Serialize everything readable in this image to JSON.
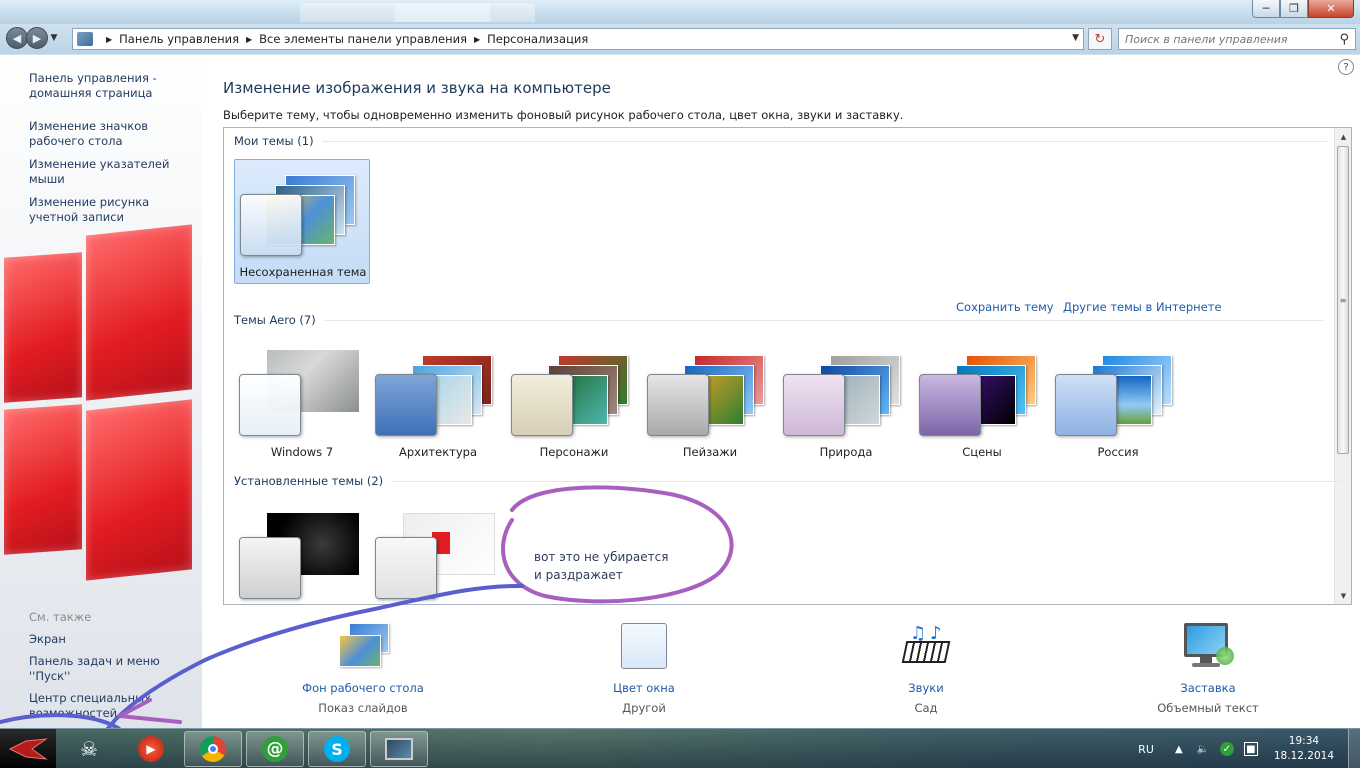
{
  "address_bar": {
    "breadcrumbs": [
      "Панель управления",
      "Все элементы панели управления",
      "Персонализация"
    ],
    "search_placeholder": "Поиск в панели управления"
  },
  "sidebar": {
    "links": [
      "Панель управления - домашняя страница",
      "Изменение значков рабочего стола",
      "Изменение указателей мыши",
      "Изменение рисунка учетной записи"
    ],
    "see_also_label": "См. также",
    "see_also_links": [
      "Экран",
      "Панель задач и меню ''Пуск''",
      "Центр специальных возможностей"
    ]
  },
  "main": {
    "title": "Изменение изображения и звука на компьютере",
    "description": "Выберите тему, чтобы одновременно изменить фоновый рисунок рабочего стола, цвет окна, звуки и заставку.",
    "groups": {
      "my_themes": {
        "label": "Мои темы (1)",
        "themes": [
          "Несохраненная тема"
        ]
      },
      "aero_themes": {
        "label": "Темы Aero (7)",
        "themes": [
          "Windows 7",
          "Архитектура",
          "Персонажи",
          "Пейзажи",
          "Природа",
          "Сцены",
          "Россия"
        ]
      },
      "installed_themes": {
        "label": "Установленные темы (2)"
      }
    },
    "save_theme_link": "Сохранить тему",
    "more_themes_link": "Другие темы в Интернете",
    "annotation": [
      "вот это не убирается",
      "и раздражает"
    ],
    "settings": [
      {
        "name": "Фон рабочего стола",
        "value": "Показ слайдов"
      },
      {
        "name": "Цвет окна",
        "value": "Другой"
      },
      {
        "name": "Звуки",
        "value": "Сад"
      },
      {
        "name": "Заставка",
        "value": "Объемный текст"
      }
    ]
  },
  "taskbar": {
    "language": "RU",
    "time": "19:34",
    "date": "18.12.2014"
  },
  "colors": {
    "link": "#1e5ba8",
    "heading": "#1e395b",
    "annotation_stroke": "#a85fbf",
    "arrow_stroke": "#5a5fd0"
  }
}
